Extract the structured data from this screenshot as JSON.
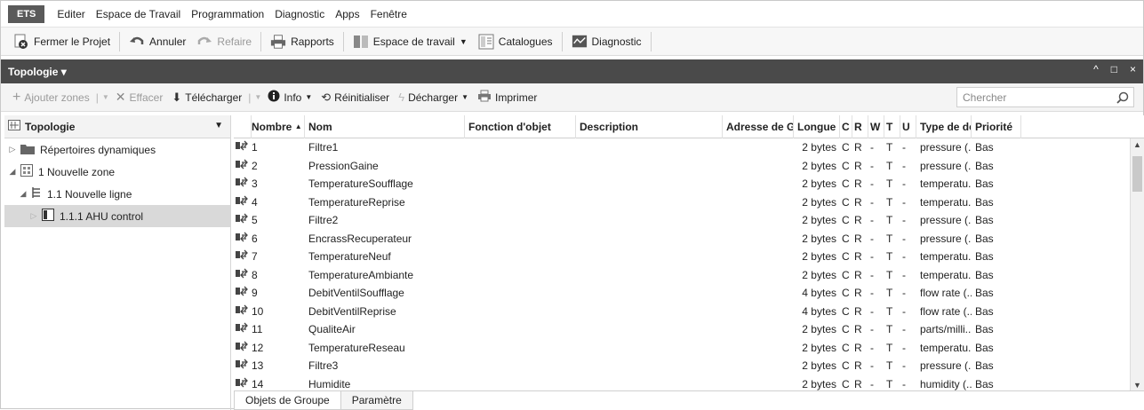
{
  "menubar": {
    "app_tab": "ETS",
    "items": [
      "Editer",
      "Espace de Travail",
      "Programmation",
      "Diagnostic",
      "Apps",
      "Fenêtre"
    ]
  },
  "toolbar": {
    "close_project": "Fermer le Projet",
    "undo": "Annuler",
    "redo": "Refaire",
    "reports": "Rapports",
    "workspace": "Espace de travail",
    "catalogs": "Catalogues",
    "diagnostic": "Diagnostic"
  },
  "panel": {
    "title": "Topologie ▾",
    "controls": [
      "^",
      "□",
      "×"
    ]
  },
  "actionbar": {
    "add_zones": "Ajouter zones",
    "delete": "Effacer",
    "download": "Télécharger",
    "info": "Info",
    "reset": "Réinitialiser",
    "unload": "Décharger",
    "print": "Imprimer",
    "search_placeholder": "Chercher"
  },
  "tree": {
    "header": "Topologie",
    "items": [
      {
        "label": "Répertoires dynamiques"
      },
      {
        "label": "1 Nouvelle zone"
      },
      {
        "label": "1.1 Nouvelle ligne"
      },
      {
        "label": "1.1.1 AHU control"
      }
    ]
  },
  "grid": {
    "columns": {
      "num": "Nombre",
      "name": "Nom",
      "function": "Fonction d'objet",
      "description": "Description",
      "address": "Adresse de Gr",
      "length": "Longue",
      "c": "C",
      "r": "R",
      "w": "W",
      "t": "T",
      "u": "U",
      "dpt": "Type de dc",
      "priority": "Priorité"
    },
    "rows": [
      {
        "num": "1",
        "name": "Filtre1",
        "len": "2 bytes",
        "c": "C",
        "r": "R",
        "w": "-",
        "t": "T",
        "u": "-",
        "dpt": "pressure (...",
        "prio": "Bas"
      },
      {
        "num": "2",
        "name": "PressionGaine",
        "len": "2 bytes",
        "c": "C",
        "r": "R",
        "w": "-",
        "t": "T",
        "u": "-",
        "dpt": "pressure (...",
        "prio": "Bas"
      },
      {
        "num": "3",
        "name": "TemperatureSoufflage",
        "len": "2 bytes",
        "c": "C",
        "r": "R",
        "w": "-",
        "t": "T",
        "u": "-",
        "dpt": "temperatu...",
        "prio": "Bas"
      },
      {
        "num": "4",
        "name": "TemperatureReprise",
        "len": "2 bytes",
        "c": "C",
        "r": "R",
        "w": "-",
        "t": "T",
        "u": "-",
        "dpt": "temperatu...",
        "prio": "Bas"
      },
      {
        "num": "5",
        "name": "Filtre2",
        "len": "2 bytes",
        "c": "C",
        "r": "R",
        "w": "-",
        "t": "T",
        "u": "-",
        "dpt": "pressure (...",
        "prio": "Bas"
      },
      {
        "num": "6",
        "name": "EncrassRecuperateur",
        "len": "2 bytes",
        "c": "C",
        "r": "R",
        "w": "-",
        "t": "T",
        "u": "-",
        "dpt": "pressure (...",
        "prio": "Bas"
      },
      {
        "num": "7",
        "name": "TemperatureNeuf",
        "len": "2 bytes",
        "c": "C",
        "r": "R",
        "w": "-",
        "t": "T",
        "u": "-",
        "dpt": "temperatu...",
        "prio": "Bas"
      },
      {
        "num": "8",
        "name": "TemperatureAmbiante",
        "len": "2 bytes",
        "c": "C",
        "r": "R",
        "w": "-",
        "t": "T",
        "u": "-",
        "dpt": "temperatu...",
        "prio": "Bas"
      },
      {
        "num": "9",
        "name": "DebitVentilSoufflage",
        "len": "4 bytes",
        "c": "C",
        "r": "R",
        "w": "-",
        "t": "T",
        "u": "-",
        "dpt": "flow rate (...",
        "prio": "Bas"
      },
      {
        "num": "10",
        "name": "DebitVentilReprise",
        "len": "4 bytes",
        "c": "C",
        "r": "R",
        "w": "-",
        "t": "T",
        "u": "-",
        "dpt": "flow rate (...",
        "prio": "Bas"
      },
      {
        "num": "11",
        "name": "QualiteAir",
        "len": "2 bytes",
        "c": "C",
        "r": "R",
        "w": "-",
        "t": "T",
        "u": "-",
        "dpt": "parts/milli...",
        "prio": "Bas"
      },
      {
        "num": "12",
        "name": "TemperatureReseau",
        "len": "2 bytes",
        "c": "C",
        "r": "R",
        "w": "-",
        "t": "T",
        "u": "-",
        "dpt": "temperatu...",
        "prio": "Bas"
      },
      {
        "num": "13",
        "name": "Filtre3",
        "len": "2 bytes",
        "c": "C",
        "r": "R",
        "w": "-",
        "t": "T",
        "u": "-",
        "dpt": "pressure (...",
        "prio": "Bas"
      },
      {
        "num": "14",
        "name": "Humidite",
        "len": "2 bytes",
        "c": "C",
        "r": "R",
        "w": "-",
        "t": "T",
        "u": "-",
        "dpt": "humidity (...",
        "prio": "Bas"
      }
    ]
  },
  "bottom_tabs": [
    "Objets de Groupe",
    "Paramètre"
  ]
}
